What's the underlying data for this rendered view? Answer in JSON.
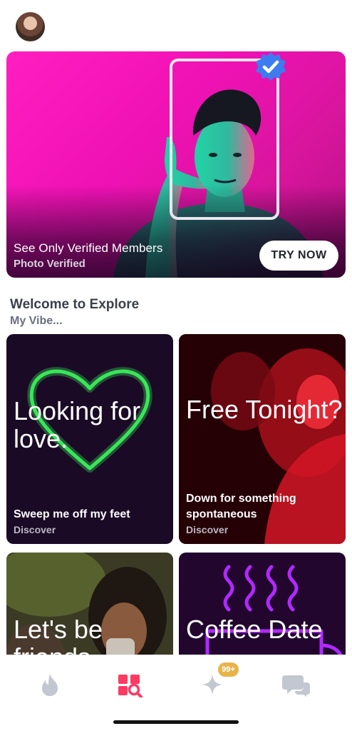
{
  "profile": {
    "avatar_icon": "profile-avatar"
  },
  "hero": {
    "title": "See Only Verified Members",
    "subtitle": "Photo Verified",
    "button_label": "TRY NOW",
    "badge_color": "#3d7cf0",
    "bg_color": "#f011b5"
  },
  "section": {
    "title": "Welcome to Explore",
    "subtitle": "My Vibe..."
  },
  "cards": [
    {
      "headline": "Looking for love.",
      "description": "Sweep me off my feet",
      "tag": "Discover",
      "accent": "#39e65a"
    },
    {
      "headline": "Free Tonight?",
      "description": "Down for something spontaneous",
      "tag": "Discover",
      "accent": "#e8121f"
    },
    {
      "headline": "Let's be friends",
      "description": "",
      "tag": ""
    },
    {
      "headline": "Coffee Date",
      "description": "",
      "tag": "",
      "accent": "#b129ff"
    }
  ],
  "tabbar": {
    "items": [
      {
        "name": "flame-icon",
        "active": false
      },
      {
        "name": "explore-icon",
        "active": true
      },
      {
        "name": "sparkle-icon",
        "active": false
      },
      {
        "name": "chat-icon",
        "active": false
      }
    ],
    "badge": "99+",
    "active_color": "#fd3a64",
    "inactive_color": "#c3c7d1"
  }
}
